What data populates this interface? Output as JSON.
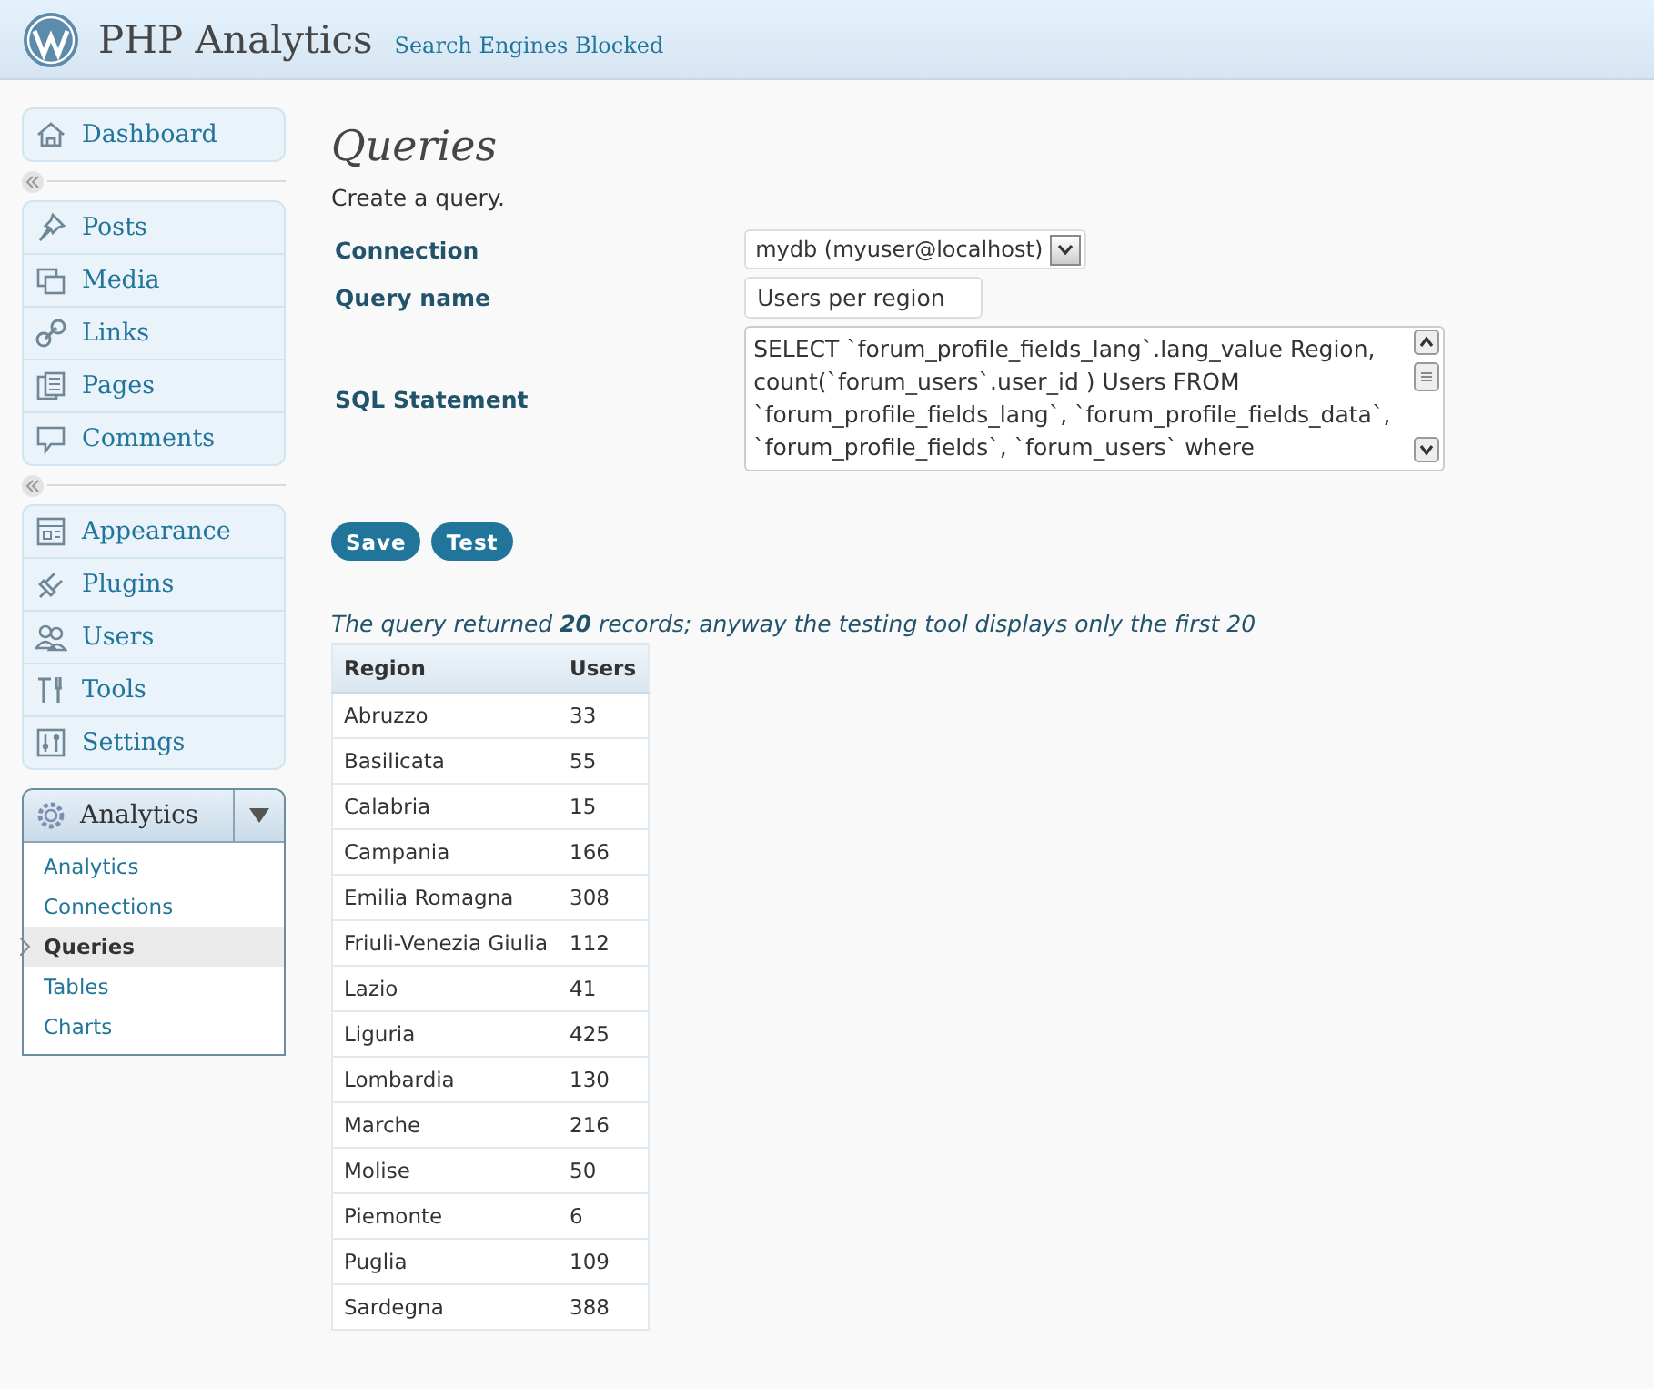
{
  "header": {
    "site_title": "PHP Analytics",
    "notice": "Search Engines Blocked"
  },
  "sidebar": {
    "groups": [
      {
        "items": [
          {
            "label": "Dashboard"
          }
        ]
      },
      {
        "items": [
          {
            "label": "Posts"
          },
          {
            "label": "Media"
          },
          {
            "label": "Links"
          },
          {
            "label": "Pages"
          },
          {
            "label": "Comments"
          }
        ]
      },
      {
        "items": [
          {
            "label": "Appearance"
          },
          {
            "label": "Plugins"
          },
          {
            "label": "Users"
          },
          {
            "label": "Tools"
          },
          {
            "label": "Settings"
          }
        ]
      }
    ],
    "plugin_menu": {
      "label": "Analytics",
      "expanded": true,
      "items": [
        {
          "label": "Analytics",
          "selected": false
        },
        {
          "label": "Connections",
          "selected": false
        },
        {
          "label": "Queries",
          "selected": true
        },
        {
          "label": "Tables",
          "selected": false
        },
        {
          "label": "Charts",
          "selected": false
        }
      ]
    }
  },
  "page": {
    "title": "Queries",
    "intro": "Create a query.",
    "form": {
      "connection": {
        "label": "Connection",
        "value": "mydb (myuser@localhost)"
      },
      "query_name": {
        "label": "Query name",
        "value": "Users per region"
      },
      "sql_statement": {
        "label": "SQL Statement",
        "value": "SELECT `forum_profile_fields_lang`.lang_value Region, count(`forum_users`.user_id ) Users FROM `forum_profile_fields_lang`, `forum_profile_fields_data`, `forum_profile_fields`, `forum_users` where"
      }
    },
    "buttons": [
      "Save",
      "Test"
    ],
    "result_message": "The query returned **20** records; anyway the testing tool displays only the first 20",
    "table": {
      "columns": [
        "Region",
        "Users"
      ],
      "rows": [
        [
          "Abruzzo",
          "33"
        ],
        [
          "Basilicata",
          "55"
        ],
        [
          "Calabria",
          "15"
        ],
        [
          "Campania",
          "166"
        ],
        [
          "Emilia Romagna",
          "308"
        ],
        [
          "Friuli-Venezia Giulia",
          "112"
        ],
        [
          "Lazio",
          "41"
        ],
        [
          "Liguria",
          "425"
        ],
        [
          "Lombardia",
          "130"
        ],
        [
          "Marche",
          "216"
        ],
        [
          "Molise",
          "50"
        ],
        [
          "Piemonte",
          "6"
        ],
        [
          "Puglia",
          "109"
        ],
        [
          "Sardegna",
          "388"
        ]
      ]
    }
  }
}
